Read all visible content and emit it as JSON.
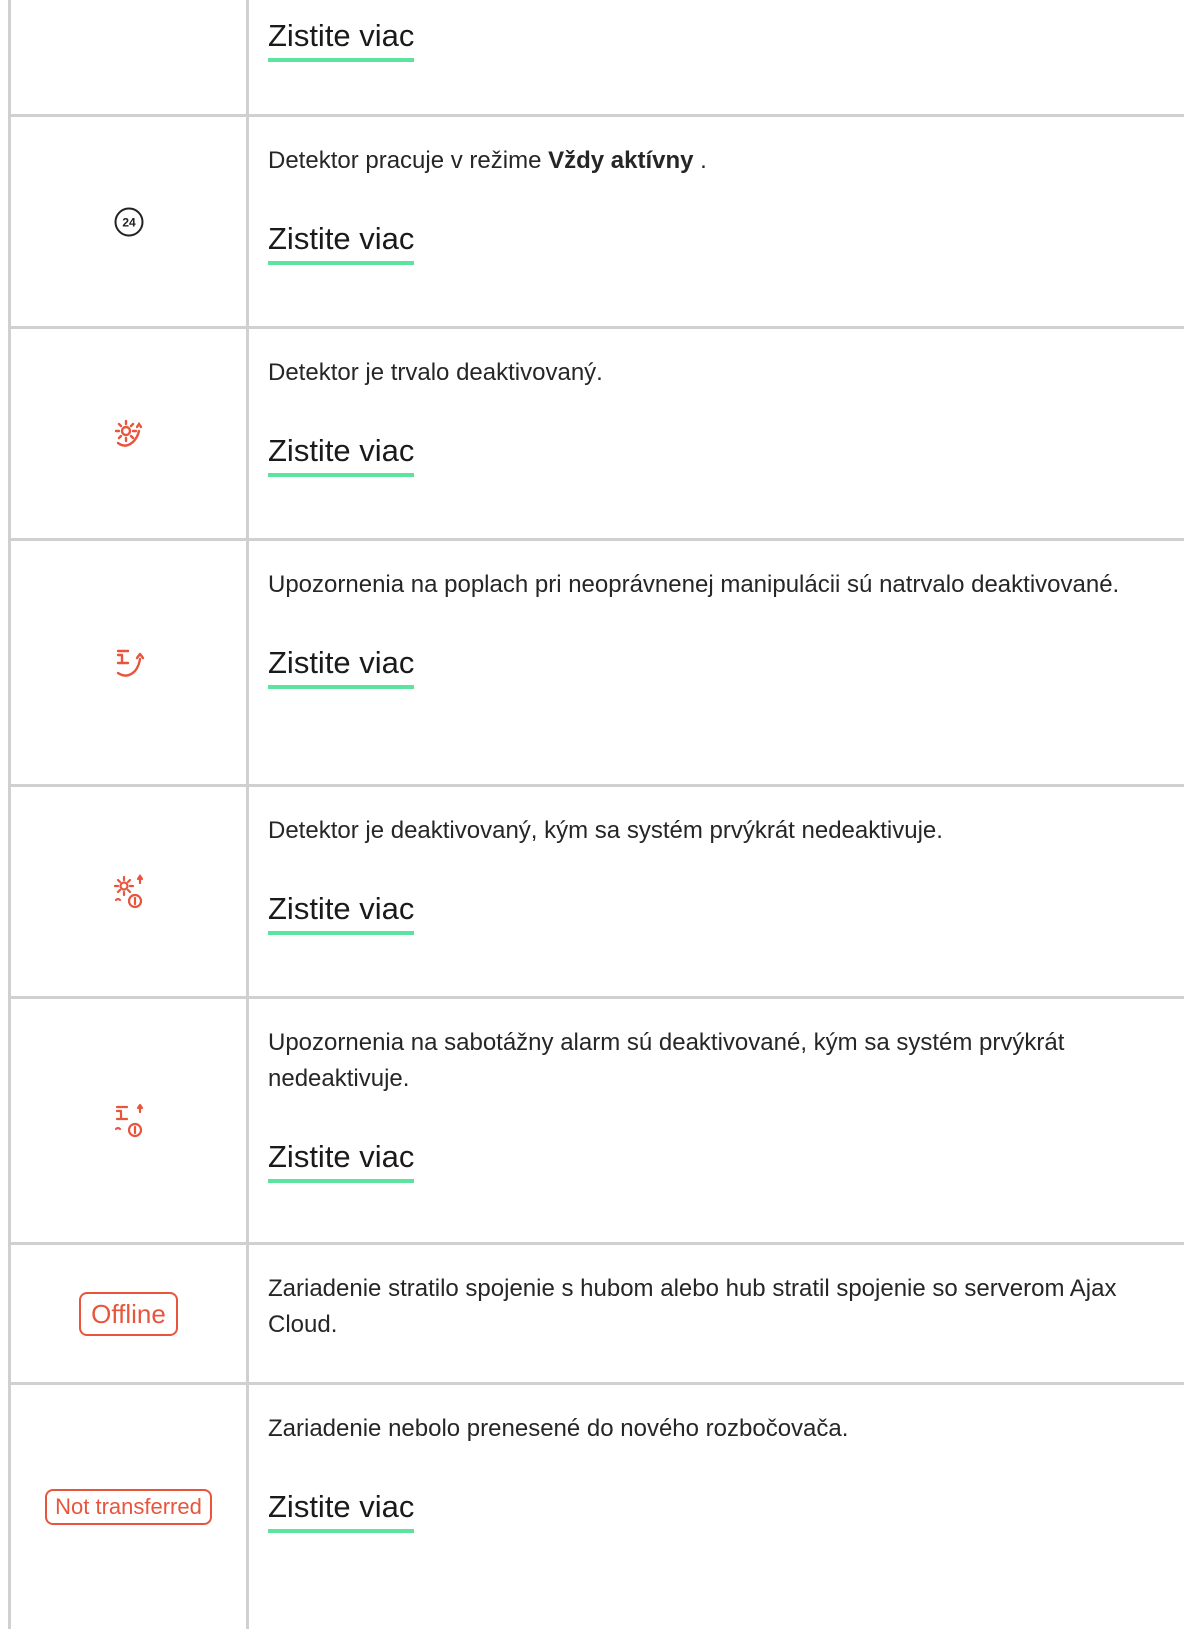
{
  "rows": [
    {
      "more_label": "Zistite viac"
    },
    {
      "icon": "always-active-24-icon",
      "desc_pre": "Detektor pracuje v režime ",
      "desc_bold": "Vždy aktívny",
      "desc_post": " .",
      "more_label": "Zistite viac"
    },
    {
      "icon": "detector-deactivated-icon",
      "desc": "Detektor je trvalo deaktivovaný.",
      "more_label": "Zistite viac"
    },
    {
      "icon": "tamper-alerts-deactivated-icon",
      "desc": "Upozornenia na poplach pri neoprávnenej manipulácii sú natrvalo deaktivované.",
      "more_label": "Zistite viac"
    },
    {
      "icon": "detector-deactivated-until-disarm-icon",
      "desc": "Detektor je deaktivovaný, kým sa systém prvýkrát nedeaktivuje.",
      "more_label": "Zistite viac"
    },
    {
      "icon": "tamper-deactivated-until-disarm-icon",
      "desc": "Upozornenia na sabotážny alarm sú deaktivované, kým sa systém prvýkrát nedeaktivuje.",
      "more_label": "Zistite viac"
    },
    {
      "badge": "Offline",
      "desc": "Zariadenie stratilo spojenie s hubom alebo hub stratil spojenie so serverom Ajax Cloud."
    },
    {
      "badge": "Not transferred",
      "desc": "Zariadenie nebolo prenesené do nového rozbočovača.",
      "more_label": "Zistite viac"
    }
  ],
  "icon_24_text": "24",
  "colors": {
    "accent_red": "#e8553d",
    "link_underline": "#5be3a0",
    "grid": "#d0d0d0"
  }
}
